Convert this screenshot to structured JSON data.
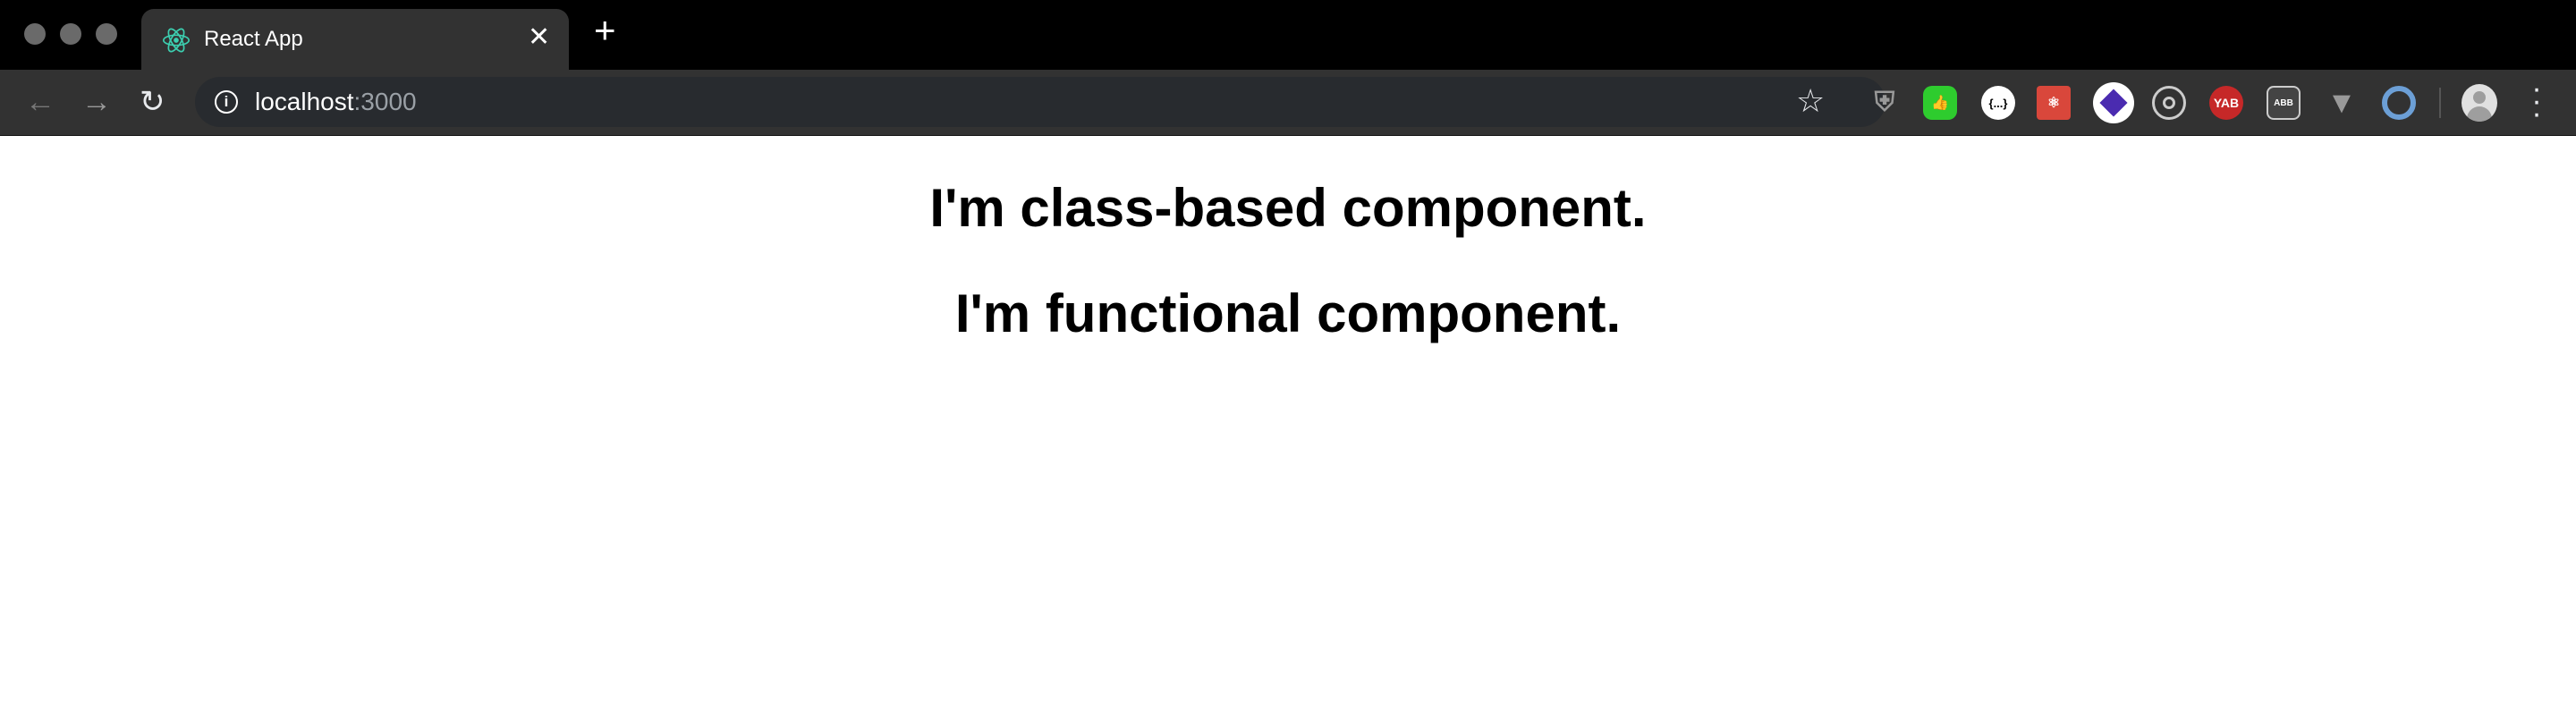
{
  "browser": {
    "tab": {
      "title": "React App",
      "icon": "react-logo-icon",
      "close_label": "✕"
    },
    "new_tab_label": "+",
    "url_host": "localhost",
    "url_port": ":3000",
    "extensions": [
      "shield-icon",
      "thumbs-up-icon",
      "json-formatter-icon",
      "react-devtools-icon",
      "layers-icon",
      "target-icon",
      "YAB",
      "adblock-icon",
      "vue-devtools-icon",
      "ring-icon"
    ],
    "yab_label": "YAB",
    "colors": {
      "tabstrip": "#000000",
      "toolbar": "#323232",
      "react": "#61dafb"
    }
  },
  "page": {
    "heading_1": "I'm class-based component.",
    "heading_2": "I'm functional component."
  }
}
